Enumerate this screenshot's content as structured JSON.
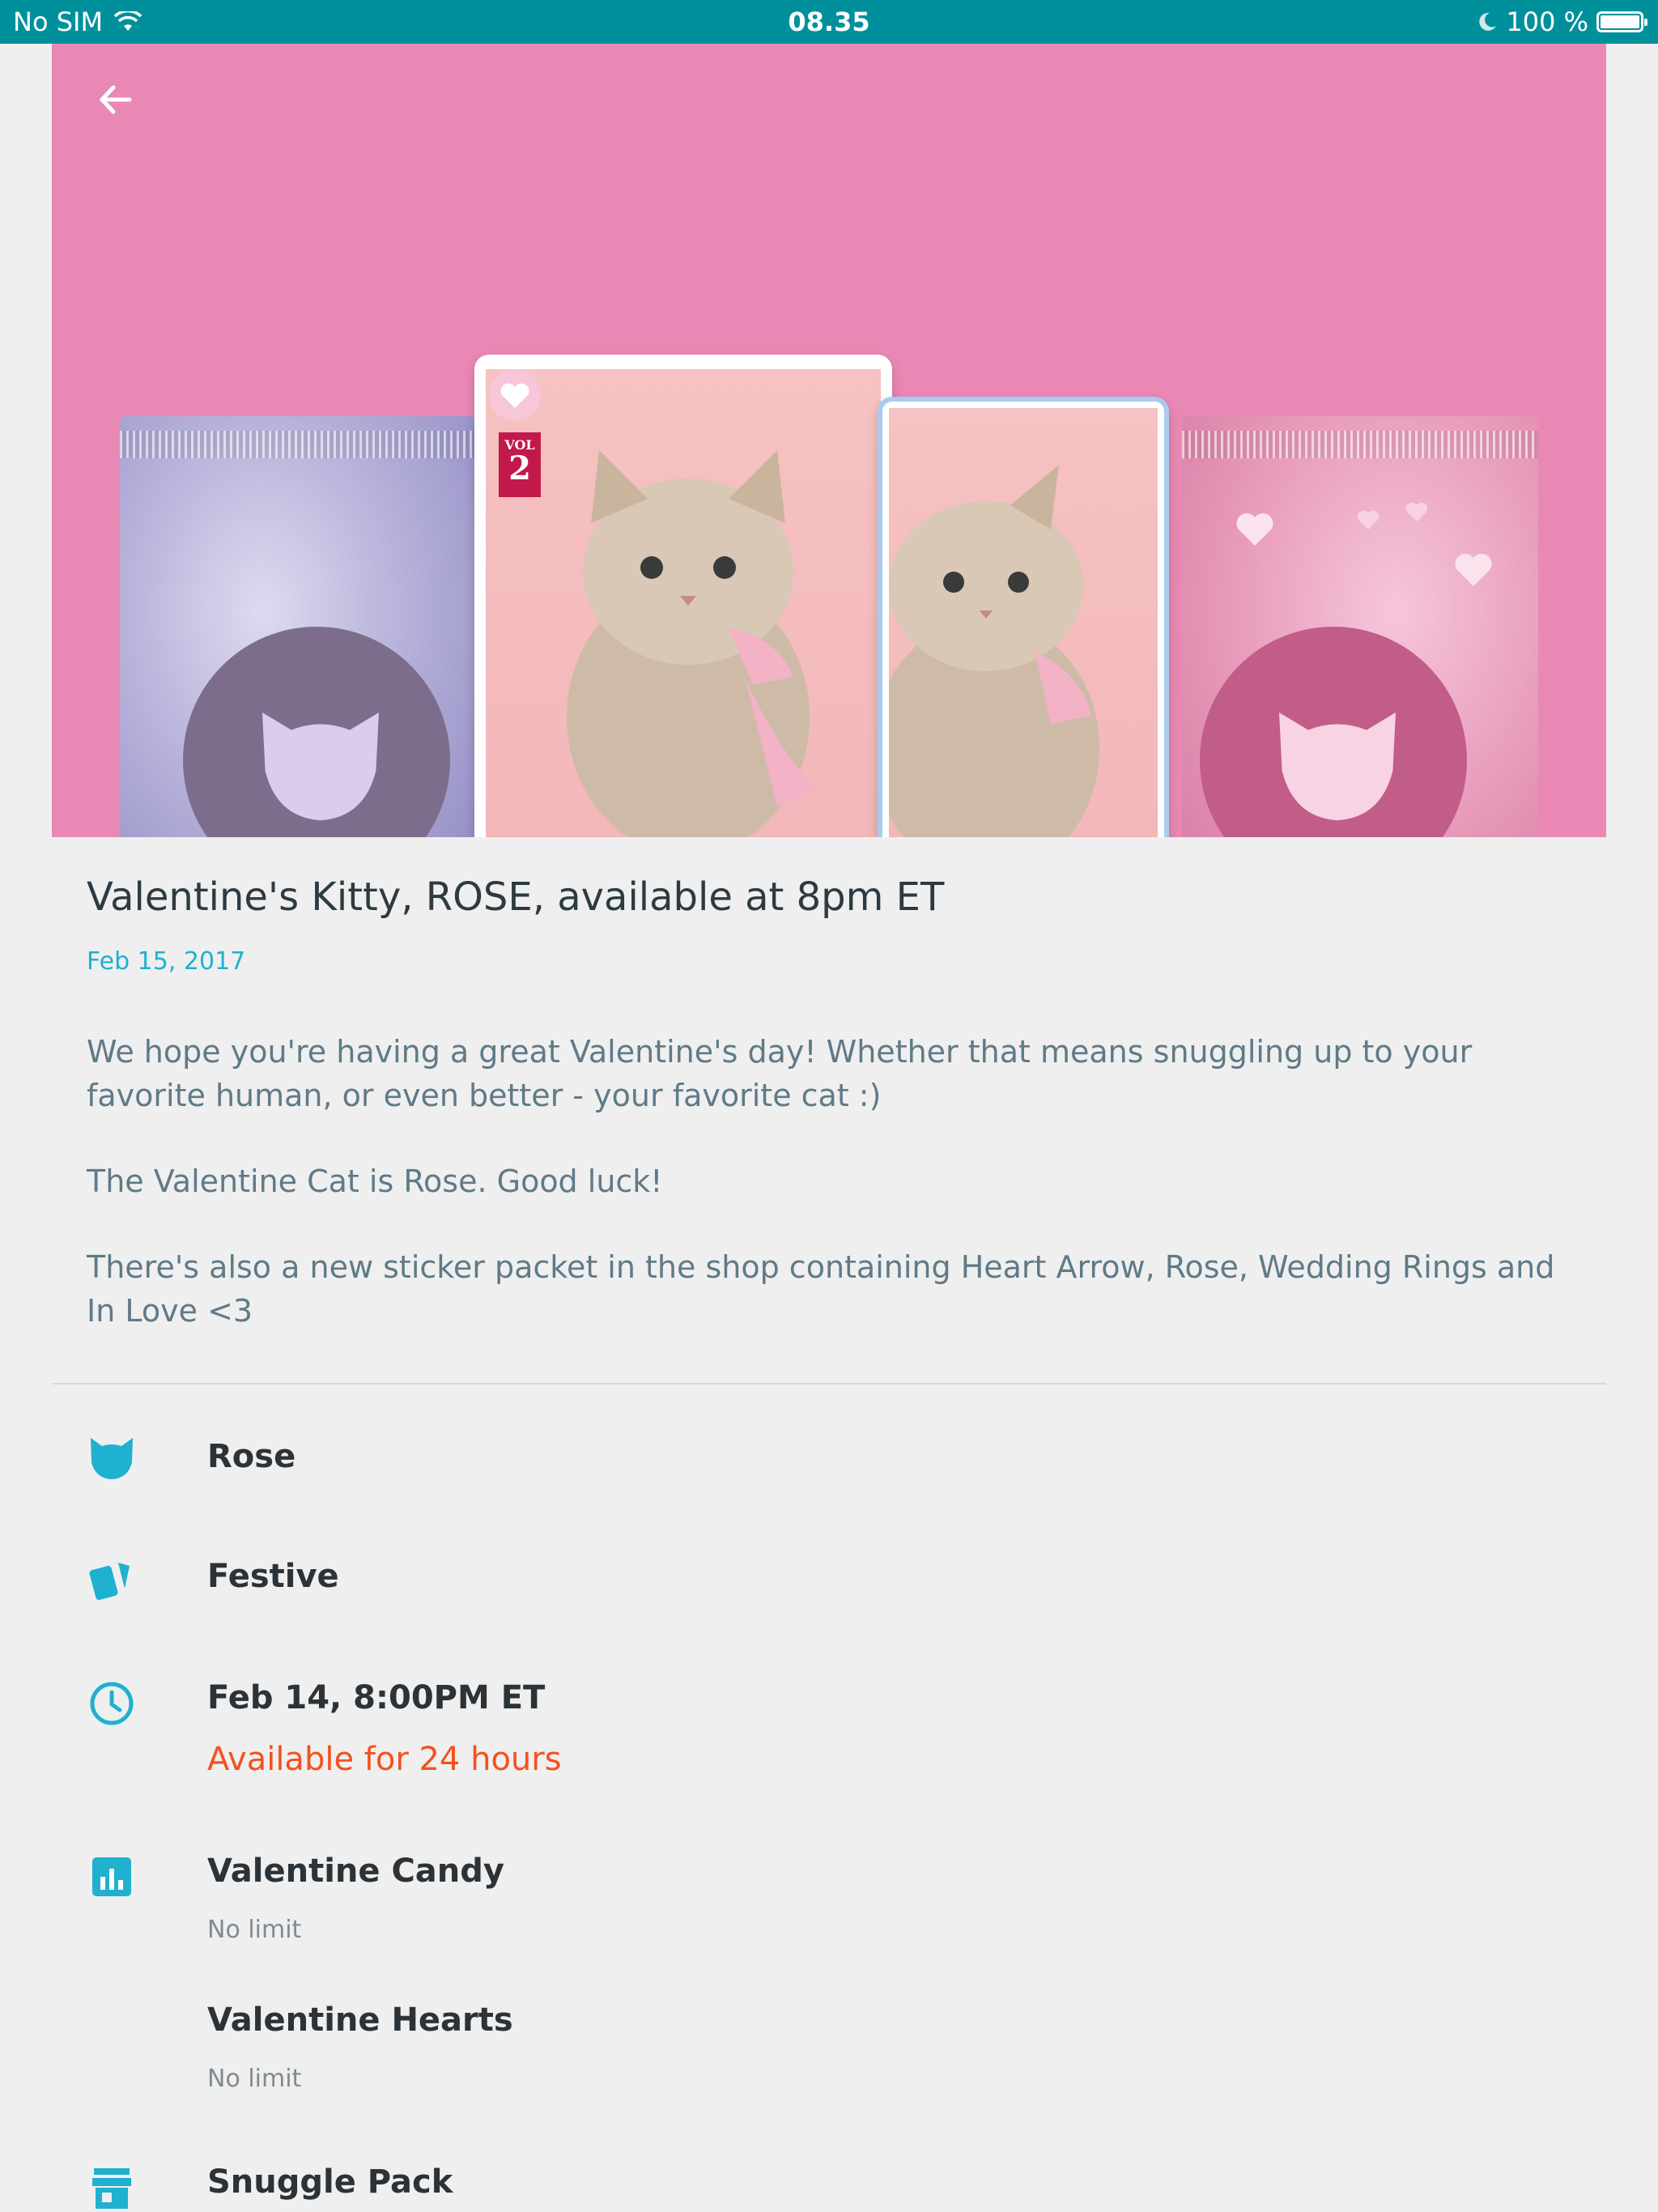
{
  "status_bar": {
    "carrier": "No SIM",
    "time": "08.35",
    "battery": "100 %"
  },
  "hero": {
    "card_volume_label": "VOL",
    "card_volume_number": "2"
  },
  "post": {
    "title": "Valentine's Kitty, ROSE, available at 8pm ET",
    "date": "Feb 15, 2017",
    "paragraphs": [
      "We hope you're having a great Valentine's day! Whether that means snuggling up to your favorite human, or even better - your favorite cat :)",
      "The Valentine Cat is Rose. Good luck!",
      "There's also a new sticker packet in the shop containing Heart Arrow, Rose, Wedding Rings and In Love <3"
    ]
  },
  "details": {
    "cat_name": "Rose",
    "card_set": "Festive",
    "start_time": "Feb 14, 8:00PM ET",
    "availability": "Available for 24 hours",
    "rewards": [
      {
        "name": "Valentine Candy",
        "limit": "No limit"
      },
      {
        "name": "Valentine Hearts",
        "limit": "No limit"
      }
    ],
    "shop_item": "Snuggle Pack"
  },
  "colors": {
    "status_bar": "#00909c",
    "hero_bg": "#ea88b5",
    "accent": "#1fb1cf",
    "availability": "#f4511e"
  }
}
